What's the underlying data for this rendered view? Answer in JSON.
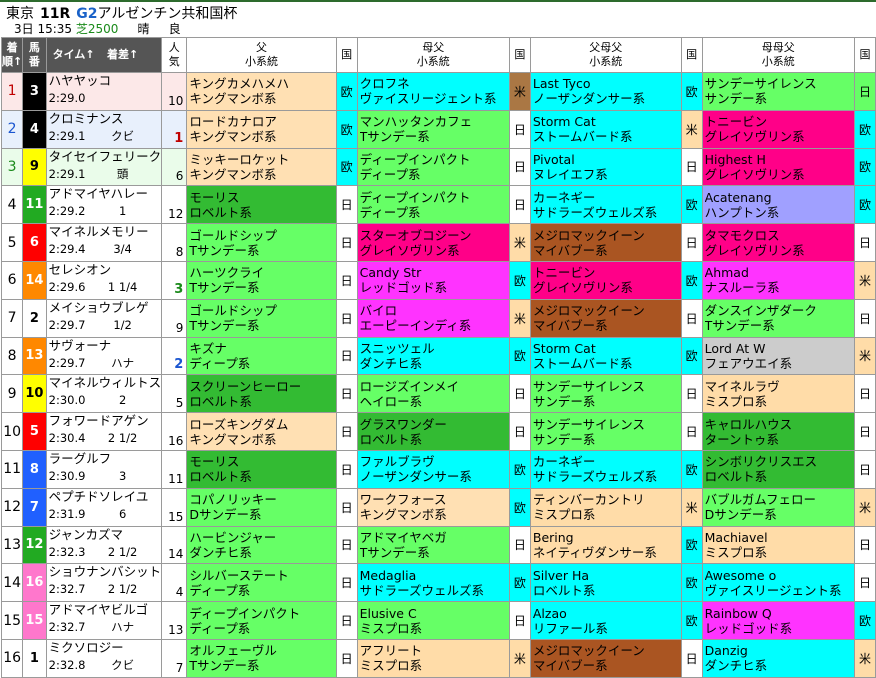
{
  "header": {
    "venue": "東京",
    "race_no": "11R",
    "grade": "G2",
    "race_name": "アルゼンチン共和国杯",
    "day": "3日",
    "time": "15:35",
    "distance": "芝2500",
    "weather": "晴",
    "going": "良"
  },
  "columns": {
    "rank": [
      "着",
      "順↑"
    ],
    "num": [
      "馬",
      "番"
    ],
    "time": "タイム↑",
    "diff": "着差↑",
    "pop": [
      "人",
      "気"
    ],
    "sire": [
      "父",
      "小系統"
    ],
    "dam_sire": [
      "母父",
      "小系統"
    ],
    "sire_sire": [
      "父母父",
      "小系統"
    ],
    "dam_dam_sire": [
      "母母父",
      "小系統"
    ],
    "country": "国"
  },
  "rows": [
    {
      "rank": "1",
      "num": "3",
      "name": "ハヤヤッコ",
      "time": "2:29.0",
      "diff": "",
      "pop": "10",
      "wc": "w1",
      "rank_cls": "",
      "num_cls": "",
      "c1": [
        "キングカメハメハ",
        "キングマンボ系"
      ],
      "k1": "c-kingmambo",
      "n1": "欧",
      "nk1": "c-obi",
      "c2": [
        "クロフネ",
        "ヴァイスリージェント系"
      ],
      "k2": "c-vice",
      "n2": "米",
      "nk2": "c-bei",
      "c3": [
        "Last Tyco",
        "ノーザンダンサー系"
      ],
      "k3": "c-vice",
      "n3": "欧",
      "nk3": "c-obi",
      "c4": [
        "サンデーサイレンス",
        "サンデー系"
      ],
      "k4": "c-sunday",
      "n4": "日",
      "nk4": "c-sunday"
    },
    {
      "rank": "2",
      "num": "4",
      "name": "クロミナンス",
      "time": "2:29.1",
      "diff": "クビ",
      "pop": "1",
      "wc": "w1",
      "c1": [
        "ロードカナロア",
        "キングマンボ系"
      ],
      "k1": "c-kingmambo",
      "n1": "欧",
      "nk1": "c-obi",
      "c2": [
        "マンハッタンカフェ",
        "Tサンデー系"
      ],
      "k2": "c-sunday",
      "n2": "日",
      "nk2": "c-wh",
      "c3": [
        "Storm Cat",
        "ストームバード系"
      ],
      "k3": "c-storm",
      "n3": "米",
      "nk3": "c-mrprospector",
      "c4": [
        "トニービン",
        "グレイソヴリン系"
      ],
      "k4": "c-greysovereign",
      "n4": "欧",
      "nk4": "c-obi"
    },
    {
      "rank": "3",
      "num": "9",
      "name": "タイセイフェリーク",
      "time": "2:29.1",
      "diff": "頭",
      "pop": "6",
      "wc": "w4",
      "c1": [
        "ミッキーロケット",
        "キングマンボ系"
      ],
      "k1": "c-kingmambo",
      "n1": "欧",
      "nk1": "c-obi",
      "c2": [
        "ディープインパクト",
        "ディープ系"
      ],
      "k2": "c-sunday",
      "n2": "日",
      "nk2": "c-wh",
      "c3": [
        "Pivotal",
        "ヌレイエフ系"
      ],
      "k3": "c-storm",
      "n3": "日",
      "nk3": "c-wh",
      "c4": [
        "Highest H",
        "グレイソヴリン系"
      ],
      "k4": "c-greysovereign",
      "n4": "欧",
      "nk4": "c-obi"
    },
    {
      "rank": "4",
      "num": "11",
      "name": "アドマイヤハレー",
      "time": "2:29.2",
      "diff": "1",
      "pop": "12",
      "wc": "w5",
      "c1": [
        "モーリス",
        "ロベルト系"
      ],
      "k1": "c-roberto",
      "n1": "日",
      "nk1": "c-wh",
      "c2": [
        "ディープインパクト",
        "ディープ系"
      ],
      "k2": "c-sunday",
      "n2": "日",
      "nk2": "c-wh",
      "c3": [
        "カーネギー",
        "サドラーズウェルズ系"
      ],
      "k3": "c-vice",
      "n3": "欧",
      "nk3": "c-obi",
      "c4": [
        "Acatenang",
        "ハンプトン系"
      ],
      "k4": "c-hampton",
      "n4": "欧",
      "nk4": "c-obi"
    },
    {
      "rank": "5",
      "num": "6",
      "name": "マイネルメモリー",
      "time": "2:29.4",
      "diff": "3/4",
      "pop": "8",
      "wc": "w2",
      "c1": [
        "ゴールドシップ",
        "Tサンデー系"
      ],
      "k1": "c-sunday",
      "n1": "日",
      "nk1": "c-wh",
      "c2": [
        "スターオブコジーン",
        "グレイソヴリン系"
      ],
      "k2": "c-greysovereign",
      "n2": "米",
      "nk2": "c-mrprospector",
      "c3": [
        "メジロマックイーン",
        "マイバブー系"
      ],
      "k3": "c-nasrullah",
      "n3": "日",
      "nk3": "c-wh",
      "c4": [
        "タマモクロス",
        "グレイソヴリン系"
      ],
      "k4": "c-greysovereign",
      "n4": "日",
      "nk4": "c-wh"
    },
    {
      "rank": "6",
      "num": "14",
      "name": "セレシオン",
      "time": "2:29.6",
      "diff": "1 1/4",
      "pop": "3",
      "wc": "w6",
      "c1": [
        "ハーツクライ",
        "Tサンデー系"
      ],
      "k1": "c-sunday",
      "n1": "日",
      "nk1": "c-wh",
      "c2": [
        "Candy Str",
        "レッドゴッド系"
      ],
      "k2": "c-redgod",
      "n2": "欧",
      "nk2": "c-obi",
      "c3": [
        "トニービン",
        "グレイソヴリン系"
      ],
      "k3": "c-greysovereign",
      "n3": "欧",
      "nk3": "c-obi",
      "c4": [
        "Ahmad",
        "ナスルーラ系"
      ],
      "k4": "c-redgod",
      "n4": "米",
      "nk4": "c-mrprospector"
    },
    {
      "rank": "7",
      "num": "2",
      "name": "メイショウブレゲ",
      "time": "2:29.7",
      "diff": "1/2",
      "pop": "9",
      "wc": "w0",
      "c1": [
        "ゴールドシップ",
        "Tサンデー系"
      ],
      "k1": "c-sunday",
      "n1": "日",
      "nk1": "c-wh",
      "c2": [
        "バイロ",
        "エーピーインディ系"
      ],
      "k2": "c-redgod",
      "n2": "米",
      "nk2": "c-mrprospector",
      "c3": [
        "メジロマックイーン",
        "マイバブー系"
      ],
      "k3": "c-nasrullah",
      "n3": "日",
      "nk3": "c-wh",
      "c4": [
        "ダンスインザダーク",
        "Tサンデー系"
      ],
      "k4": "c-sunday",
      "n4": "日",
      "nk4": "c-wh"
    },
    {
      "rank": "8",
      "num": "13",
      "name": "サヴォーナ",
      "time": "2:29.7",
      "diff": "ハナ",
      "pop": "2",
      "wc": "w6",
      "c1": [
        "キズナ",
        "ディープ系"
      ],
      "k1": "c-sunday",
      "n1": "日",
      "nk1": "c-wh",
      "c2": [
        "スニッツェル",
        "ダンチヒ系"
      ],
      "k2": "c-vice",
      "n2": "欧",
      "nk2": "c-obi",
      "c3": [
        "Storm Cat",
        "ストームバード系"
      ],
      "k3": "c-storm",
      "n3": "欧",
      "nk3": "c-obi",
      "c4": [
        "Lord At W",
        "フェアウエイ系"
      ],
      "k4": "c-fairway",
      "n4": "米",
      "nk4": "c-mrprospector"
    },
    {
      "rank": "9",
      "num": "10",
      "name": "マイネルウィルトス",
      "time": "2:30.0",
      "diff": "2",
      "pop": "5",
      "wc": "w4",
      "c1": [
        "スクリーンヒーロー",
        "ロベルト系"
      ],
      "k1": "c-roberto",
      "n1": "日",
      "nk1": "c-wh",
      "c2": [
        "ロージズインメイ",
        "ヘイロー系"
      ],
      "k2": "c-sunday",
      "n2": "日",
      "nk2": "c-wh",
      "c3": [
        "サンデーサイレンス",
        "サンデー系"
      ],
      "k3": "c-sunday",
      "n3": "日",
      "nk3": "c-wh",
      "c4": [
        "マイネルラヴ",
        "ミスプロ系"
      ],
      "k4": "c-mrprospector",
      "n4": "日",
      "nk4": "c-wh"
    },
    {
      "rank": "10",
      "num": "5",
      "name": "フォワードアゲン",
      "time": "2:30.4",
      "diff": "2 1/2",
      "pop": "16",
      "wc": "w2",
      "c1": [
        "ローズキングダム",
        "キングマンボ系"
      ],
      "k1": "c-kingmambo",
      "n1": "日",
      "nk1": "c-wh",
      "c2": [
        "グラスワンダー",
        "ロベルト系"
      ],
      "k2": "c-roberto",
      "n2": "日",
      "nk2": "c-wh",
      "c3": [
        "サンデーサイレンス",
        "サンデー系"
      ],
      "k3": "c-sunday",
      "n3": "日",
      "nk3": "c-wh",
      "c4": [
        "キャロルハウス",
        "ターントゥ系"
      ],
      "k4": "c-turnto",
      "n4": "日",
      "nk4": "c-wh"
    },
    {
      "rank": "11",
      "num": "8",
      "name": "ラーグルフ",
      "time": "2:30.9",
      "diff": "3",
      "pop": "11",
      "wc": "w3",
      "c1": [
        "モーリス",
        "ロベルト系"
      ],
      "k1": "c-roberto",
      "n1": "日",
      "nk1": "c-wh",
      "c2": [
        "ファルブラヴ",
        "ノーザンダンサー系"
      ],
      "k2": "c-vice",
      "n2": "欧",
      "nk2": "c-obi",
      "c3": [
        "カーネギー",
        "サドラーズウェルズ系"
      ],
      "k3": "c-vice",
      "n3": "欧",
      "nk3": "c-obi",
      "c4": [
        "シンボリクリスエス",
        "ロベルト系"
      ],
      "k4": "c-roberto",
      "n4": "日",
      "nk4": "c-wh"
    },
    {
      "rank": "12",
      "num": "7",
      "name": "ペプチドソレイユ",
      "time": "2:31.9",
      "diff": "6",
      "pop": "15",
      "wc": "w3",
      "c1": [
        "コパノリッキー",
        "Dサンデー系"
      ],
      "k1": "c-sunday",
      "n1": "日",
      "nk1": "c-wh",
      "c2": [
        "ワークフォース",
        "キングマンボ系"
      ],
      "k2": "c-kingmambo",
      "n2": "欧",
      "nk2": "c-obi",
      "c3": [
        "ティンバーカントリ",
        "ミスプロ系"
      ],
      "k3": "c-mrprospector",
      "n3": "米",
      "nk3": "c-mrprospector",
      "c4": [
        "バブルガムフェロー",
        "Dサンデー系"
      ],
      "k4": "c-sunday",
      "n4": "米",
      "nk4": "c-mrprospector"
    },
    {
      "rank": "13",
      "num": "12",
      "name": "ジャンカズマ",
      "time": "2:32.3",
      "diff": "2 1/2",
      "pop": "14",
      "wc": "w5",
      "c1": [
        "ハービンジャー",
        "ダンチヒ系"
      ],
      "k1": "c-sunday",
      "n1": "日",
      "nk1": "c-wh",
      "c2": [
        "アドマイヤベガ",
        "Tサンデー系"
      ],
      "k2": "c-sunday",
      "n2": "日",
      "nk2": "c-wh",
      "c3": [
        "Bering",
        "ネイティヴダンサー系"
      ],
      "k3": "c-mrprospector",
      "n3": "欧",
      "nk3": "c-obi",
      "c4": [
        "Machiavel",
        "ミスプロ系"
      ],
      "k4": "c-mrprospector",
      "n4": "日",
      "nk4": "c-wh"
    },
    {
      "rank": "14",
      "num": "16",
      "name": "ショウナンバシット",
      "time": "2:32.7",
      "diff": "2 1/2",
      "pop": "4",
      "wc": "w7",
      "c1": [
        "シルバーステート",
        "ディープ系"
      ],
      "k1": "c-sunday",
      "n1": "日",
      "nk1": "c-wh",
      "c2": [
        "Medaglia",
        "サドラーズウェルズ系"
      ],
      "k2": "c-vice",
      "n2": "欧",
      "nk2": "c-obi",
      "c3": [
        "Silver Ha",
        "ロベルト系"
      ],
      "k3": "c-storm",
      "n3": "欧",
      "nk3": "c-obi",
      "c4": [
        "Awesome o",
        "ヴァイスリージェント系"
      ],
      "k4": "c-vice",
      "n4": "日",
      "nk4": "c-wh"
    },
    {
      "rank": "15",
      "num": "15",
      "name": "アドマイヤビルゴ",
      "time": "2:32.7",
      "diff": "ハナ",
      "pop": "13",
      "wc": "w7",
      "c1": [
        "ディープインパクト",
        "ディープ系"
      ],
      "k1": "c-sunday",
      "n1": "日",
      "nk1": "c-wh",
      "c2": [
        "Elusive C",
        "ミスプロ系"
      ],
      "k2": "c-sunday",
      "n2": "日",
      "nk2": "c-wh",
      "c3": [
        "Alzao",
        "リファール系"
      ],
      "k3": "c-vice",
      "n3": "欧",
      "nk3": "c-obi",
      "c4": [
        "Rainbow Q",
        "レッドゴッド系"
      ],
      "k4": "c-redgod",
      "n4": "欧",
      "nk4": "c-obi"
    },
    {
      "rank": "16",
      "num": "1",
      "name": "ミクソロジー",
      "time": "2:32.8",
      "diff": "クビ",
      "pop": "7",
      "wc": "w0",
      "c1": [
        "オルフェーヴル",
        "Tサンデー系"
      ],
      "k1": "c-sunday",
      "n1": "日",
      "nk1": "c-wh",
      "c2": [
        "アフリート",
        "ミスプロ系"
      ],
      "k2": "c-mrprospector",
      "n2": "米",
      "nk2": "c-mrprospector",
      "c3": [
        "メジロマックイーン",
        "マイバブー系"
      ],
      "k3": "c-nasrullah",
      "n3": "日",
      "nk3": "c-wh",
      "c4": [
        "Danzig",
        "ダンチヒ系"
      ],
      "k4": "c-vice",
      "n4": "米",
      "nk4": "c-mrprospector"
    }
  ]
}
